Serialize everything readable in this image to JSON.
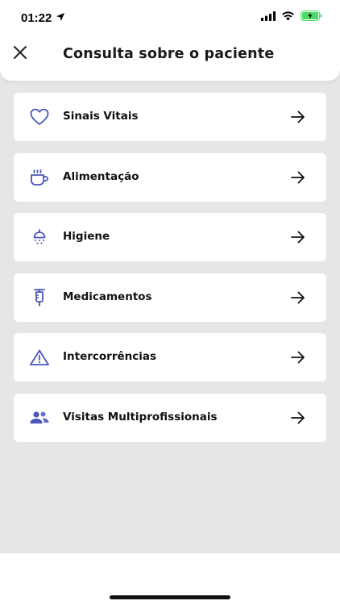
{
  "status_bar": {
    "time": "01:22"
  },
  "header": {
    "title": "Consulta sobre o paciente",
    "close_icon": "close-icon"
  },
  "menu": {
    "items": [
      {
        "label": "Sinais Vitais",
        "icon": "heart-icon"
      },
      {
        "label": "Alimentação",
        "icon": "cup-icon"
      },
      {
        "label": "Higiene",
        "icon": "shower-icon"
      },
      {
        "label": "Medicamentos",
        "icon": "syringe-icon"
      },
      {
        "label": "Intercorrências",
        "icon": "warning-icon"
      },
      {
        "label": "Visitas Multiprofissionais",
        "icon": "people-icon"
      }
    ]
  },
  "colors": {
    "accent": "#4a55b8",
    "background": "#e6e6e6",
    "card": "#ffffff",
    "text": "#111111",
    "battery": "#4cd964"
  }
}
